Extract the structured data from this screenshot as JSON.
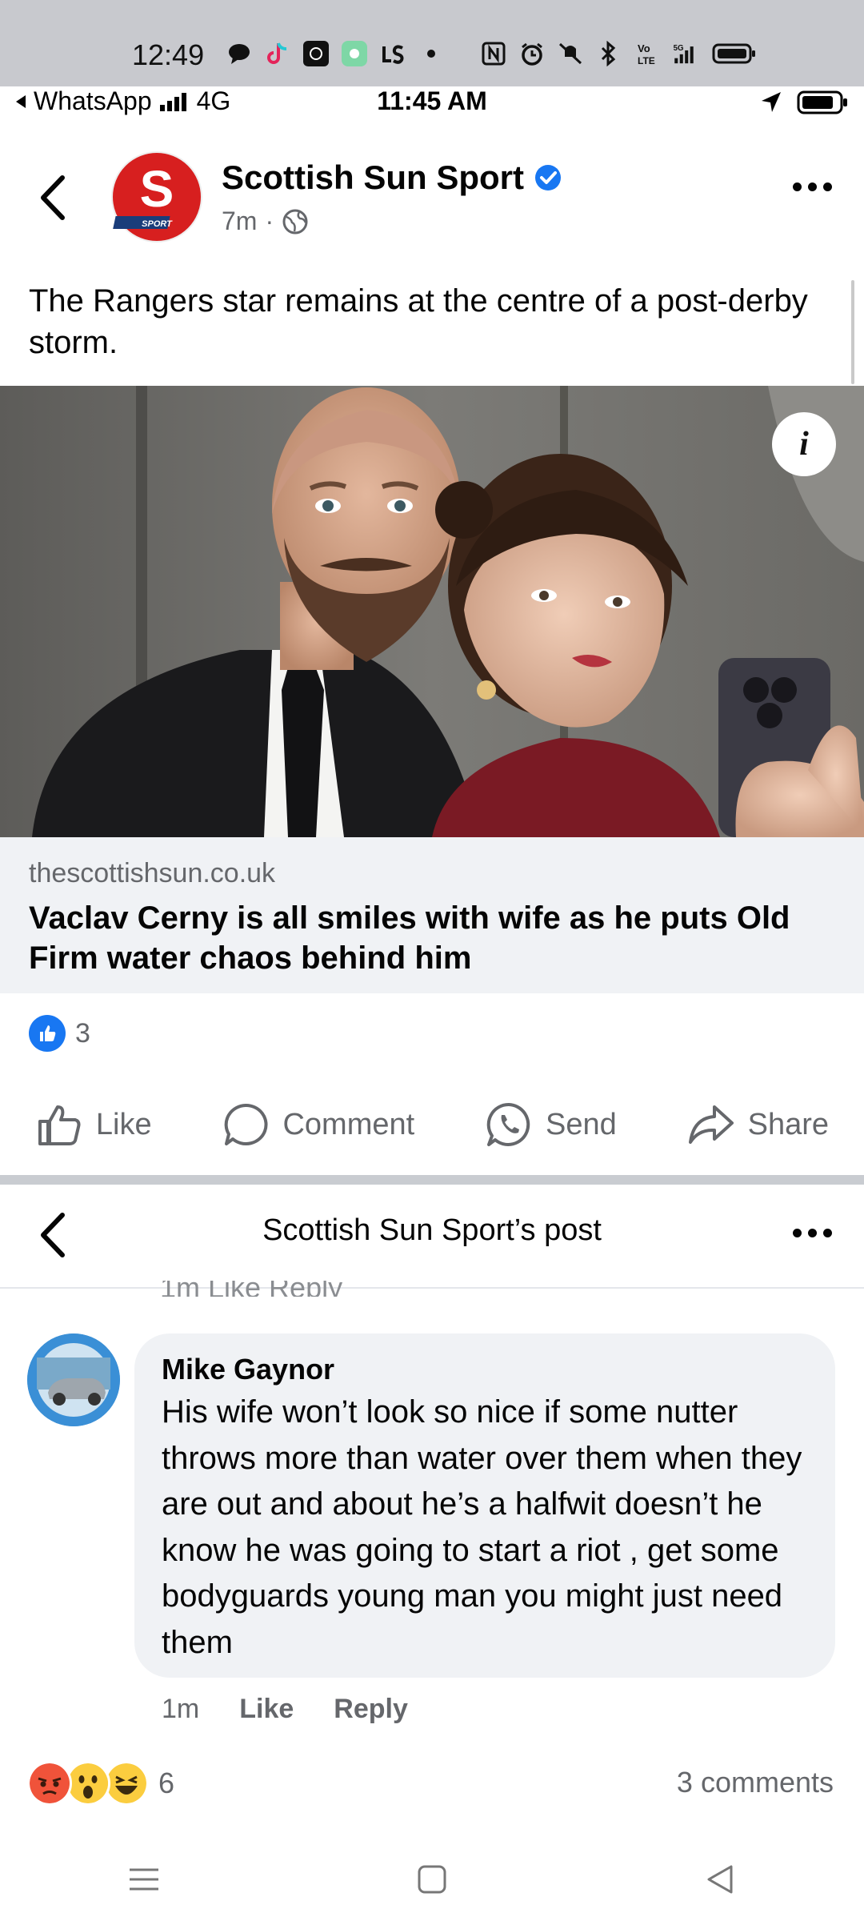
{
  "android_status": {
    "time": "12:49"
  },
  "ios_status": {
    "back_app": "WhatsApp",
    "network": "4G",
    "time": "11:45 AM"
  },
  "post": {
    "page_name": "Scottish Sun Sport",
    "time_ago": "7m",
    "separator": "·",
    "avatar_letter": "S",
    "avatar_tag": "SPORT",
    "text": "The Rangers star remains at the centre of a post-derby storm.",
    "link_domain": "thescottishsun.co.uk",
    "link_title": "Vaclav Cerny is all smiles with wife as he puts Old Firm water chaos behind him",
    "like_count": "3",
    "info_label": "i"
  },
  "actions": {
    "like": "Like",
    "comment": "Comment",
    "send": "Send",
    "share": "Share"
  },
  "comments_view": {
    "title": "Scottish Sun Sport’s post",
    "cutoff_text": "1m Like Reply",
    "comment": {
      "author": "Mike Gaynor",
      "text": "His wife won’t look so nice if some nutter throws more than water over them when they are out and about he’s a halfwit doesn’t he know he was going to start a riot , get some bodyguards young man you might just need them",
      "time": "1m",
      "like": "Like",
      "reply": "Reply"
    },
    "reaction_count": "6",
    "comments_count": "3 comments"
  },
  "colors": {
    "brand_blue": "#1877f2",
    "sun_red": "#d71f1f",
    "muted": "#65676b",
    "bubble": "#f0f2f5"
  }
}
